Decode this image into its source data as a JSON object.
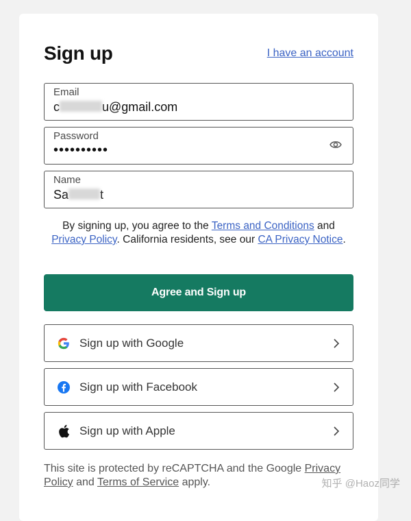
{
  "header": {
    "title": "Sign up",
    "have_account_link": "I have an account"
  },
  "fields": {
    "email": {
      "label": "Email",
      "value_prefix": "c",
      "value_suffix": "u@gmail.com"
    },
    "password": {
      "label": "Password",
      "value": "••••••••••"
    },
    "name": {
      "label": "Name",
      "value_prefix": "Sa",
      "value_suffix": "t"
    }
  },
  "consent": {
    "part1": "By signing up, you agree to the ",
    "terms_link": "Terms and Conditions",
    "part2": " and ",
    "privacy_link": "Privacy Policy",
    "part3": ". California residents, see our ",
    "ca_link": "CA Privacy Notice",
    "part4": "."
  },
  "buttons": {
    "primary": "Agree and Sign up",
    "google": "Sign up with Google",
    "facebook": "Sign up with Facebook",
    "apple": "Sign up with Apple"
  },
  "recaptcha": {
    "part1": "This site is protected by reCAPTCHA and the Google ",
    "privacy_link": "Privacy Policy",
    "part2": " and ",
    "tos_link": "Terms of Service",
    "part3": " apply."
  },
  "watermark": "知乎 @Haoz同学",
  "colors": {
    "primary": "#157a61",
    "link": "#3b63c4",
    "background": "#f2f2f2",
    "facebook": "#1877f2"
  },
  "icons": [
    "google-icon",
    "facebook-icon",
    "apple-icon",
    "chevron-right-icon",
    "eye-icon"
  ]
}
